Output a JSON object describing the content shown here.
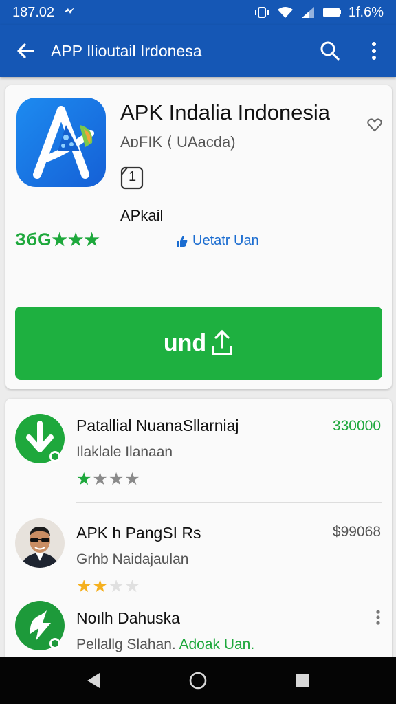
{
  "status_bar": {
    "time": "187.02",
    "battery": "1f.6%"
  },
  "app_bar": {
    "title": "APP Ilioutail Irdonesa"
  },
  "app": {
    "title": "APK Indalia Indonesia",
    "subtitle": "AɒFIK ⟨ UAacda)",
    "badge": "1",
    "category": "APkail",
    "rating_text": "ЗбG★★★",
    "update_link": "Uetatr Uan",
    "install_label": "und"
  },
  "list": [
    {
      "title": "Patallial NuanaSllarniaj",
      "subtitle": "Ilaklale Ilanaan",
      "price": "330000",
      "stars_filled": "★",
      "stars_empty": "★★★",
      "filled_color": "#1ea83c"
    },
    {
      "title": "APK h PangSI Rs",
      "subtitle": "Grhb Naidajaulan",
      "price": "$99068",
      "stars_filled": "★★",
      "stars_empty": "★★",
      "filled_color": "#f5b01e"
    },
    {
      "title": "Noılh Dahuska",
      "subtitle": "Pellallg Slahan.",
      "link": "Adoak Uan."
    }
  ],
  "colors": {
    "primary": "#1557b5",
    "accent_green": "#1eb040",
    "link_blue": "#1a6cd0"
  },
  "icons": [
    "arrow-left-icon",
    "search-icon",
    "more-vert-icon",
    "heart-icon",
    "thumbs-up-icon",
    "upload-icon",
    "back-triangle-icon",
    "home-circle-icon",
    "recents-square-icon"
  ]
}
